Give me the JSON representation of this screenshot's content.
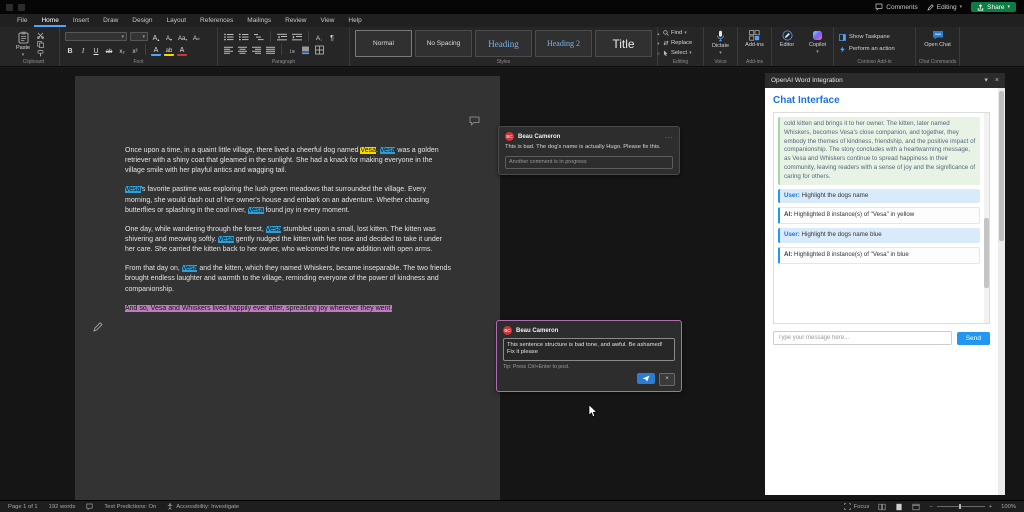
{
  "colors": {
    "accent_blue": "#4da3ff",
    "share_green": "#0f7b44",
    "send_blue": "#2196f3",
    "highlight_yellow": "#f5d800",
    "highlight_blue": "#2e9ed6",
    "highlight_purple": "#bd7cbd",
    "avatar_red": "#d13438"
  },
  "title_bar": {
    "comments": "Comments",
    "editing": "Editing",
    "share": "Share"
  },
  "menu_tabs": [
    {
      "label": "File",
      "active": false
    },
    {
      "label": "Home",
      "active": true
    },
    {
      "label": "Insert",
      "active": false
    },
    {
      "label": "Draw",
      "active": false
    },
    {
      "label": "Design",
      "active": false
    },
    {
      "label": "Layout",
      "active": false
    },
    {
      "label": "References",
      "active": false
    },
    {
      "label": "Mailings",
      "active": false
    },
    {
      "label": "Review",
      "active": false
    },
    {
      "label": "View",
      "active": false
    },
    {
      "label": "Help",
      "active": false
    }
  ],
  "ribbon": {
    "paste": "Paste",
    "clipboard_label": "Clipboard",
    "font_label": "Font",
    "paragraph_label": "Paragraph",
    "styles_label": "Styles",
    "styles": [
      {
        "name": "Normal",
        "class": "s-normal"
      },
      {
        "name": "No Spacing",
        "class": "s-nospace"
      },
      {
        "name": "Heading",
        "class": "s-h1"
      },
      {
        "name": "Heading 2",
        "class": "s-h2"
      },
      {
        "name": "Title",
        "class": "s-title"
      }
    ],
    "find": "Find",
    "replace": "Replace",
    "select": "Select",
    "editing_label": "Editing",
    "dictate": "Dictate",
    "voice_label": "Voice",
    "addins": "Add-ins",
    "addins_label": "Add-ins",
    "editor": "Editor",
    "copilot": "Copilot",
    "show_taskpane": "Show Taskpane",
    "perform_action": "Perform an action",
    "contoso_label": "Contoso Add-in",
    "open_chat": "Open Chat",
    "chat_label": "Chat Commands"
  },
  "document": {
    "paragraphs": [
      {
        "segments": [
          {
            "t": "Once upon a time, in a quaint little village, there lived a cheerful dog named "
          },
          {
            "t": "Vesa",
            "h": "yellow"
          },
          {
            "t": ". "
          },
          {
            "t": "Vesa",
            "h": "blue"
          },
          {
            "t": " was a golden retriever with a shiny coat that gleamed in the sunlight. She had a knack for making everyone in the village smile with her playful antics and wagging tail."
          }
        ]
      },
      {
        "segments": [
          {
            "t": "Vesa",
            "h": "blue"
          },
          {
            "t": "'s favorite pastime was exploring the lush green meadows that surrounded the village. Every morning, she would dash out of her owner's house and embark on an adventure. Whether chasing butterflies or splashing in the cool river, "
          },
          {
            "t": "Vesa",
            "h": "blue"
          },
          {
            "t": " found joy in every moment."
          }
        ]
      },
      {
        "segments": [
          {
            "t": "One day, while wandering through the forest, "
          },
          {
            "t": "Vesa",
            "h": "blue"
          },
          {
            "t": " stumbled upon a small, lost kitten. The kitten was shivering and meowing softly. "
          },
          {
            "t": "Vesa",
            "h": "blue"
          },
          {
            "t": " gently nudged the kitten with her nose and decided to take it under her care. She carried the kitten back to her owner, who welcomed the new addition with open arms."
          }
        ]
      },
      {
        "segments": [
          {
            "t": "From that day on, "
          },
          {
            "t": "Vesa",
            "h": "blue"
          },
          {
            "t": " and the kitten, which they named Whiskers, became inseparable. The two friends brought endless laughter and warmth to the village, reminding everyone of the power of kindness and companionship."
          }
        ]
      },
      {
        "segments": [
          {
            "t": "And so, Vesa and Whiskers lived happily ever after, spreading joy wherever they went.",
            "h": "purple"
          }
        ]
      }
    ]
  },
  "comments": {
    "card1": {
      "avatar_initials": "BC",
      "author": "Beau Cameron",
      "text": "This is bad. The dog's name is actually Hugo. Please fix this.",
      "menu": "...",
      "reply_placeholder": "Another comment is in progress"
    },
    "card2": {
      "avatar_initials": "BC",
      "author": "Beau Cameron",
      "text": "This sentence structure is bad tone, and awful. Be ashamed! Fix it please",
      "tip": "Tip: Press Ctrl+Enter to post."
    }
  },
  "panel": {
    "title": "OpenAI Word Integration",
    "heading": "Chat Interface",
    "messages": [
      {
        "style": "long",
        "prefix": "",
        "text": "cold kitten and brings it to her owner. The kitten, later named Whiskers, becomes Vesa's close companion, and together, they embody the themes of kindness, friendship, and the positive impact of companionship. The story concludes with a heartwarming message, as Vesa and Whiskers continue to spread happiness in their community, leaving readers with a sense of joy and the significance of caring for others."
      },
      {
        "style": "user",
        "prefix": "User:",
        "text": " Highlight the dogs name"
      },
      {
        "style": "ai",
        "prefix": "AI:",
        "text": " Highlighted 8 instance(s) of \"Vesa\" in yellow"
      },
      {
        "style": "user",
        "prefix": "User:",
        "text": " Highlight the dogs name blue"
      },
      {
        "style": "ai",
        "prefix": "AI:",
        "text": " Highlighted 8 instance(s) of \"Vesa\" in blue"
      }
    ],
    "input_placeholder": "Type your message here...",
    "send": "Send"
  },
  "status_bar": {
    "page": "Page 1 of 1",
    "words": "192 words",
    "predictions": "Text Predictions: On",
    "accessibility": "Accessibility: Investigate",
    "focus": "Focus",
    "zoom": "100%"
  }
}
